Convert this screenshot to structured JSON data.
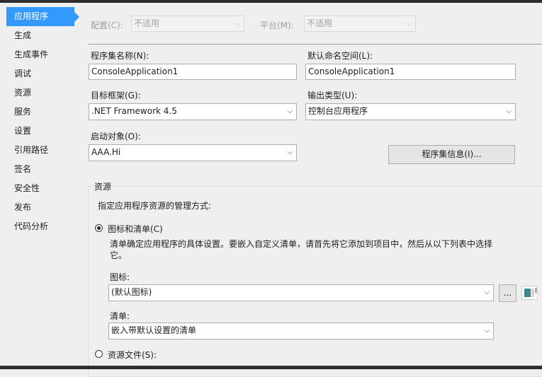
{
  "sidebar": {
    "items": [
      {
        "label": "应用程序",
        "active": true
      },
      {
        "label": "生成"
      },
      {
        "label": "生成事件"
      },
      {
        "label": "调试"
      },
      {
        "label": "资源"
      },
      {
        "label": "服务"
      },
      {
        "label": "设置"
      },
      {
        "label": "引用路径"
      },
      {
        "label": "签名"
      },
      {
        "label": "安全性"
      },
      {
        "label": "发布"
      },
      {
        "label": "代码分析"
      }
    ]
  },
  "config": {
    "label": "配置(C):",
    "value": "不适用",
    "platform_label": "平台(M):",
    "platform_value": "不适用"
  },
  "form": {
    "assembly_name_label": "程序集名称(N):",
    "assembly_name": "ConsoleApplication1",
    "namespace_label": "默认命名空间(L):",
    "namespace": "ConsoleApplication1",
    "framework_label": "目标框架(G):",
    "framework": ".NET Framework 4.5",
    "output_type_label": "输出类型(U):",
    "output_type": "控制台应用程序",
    "startup_label": "启动对象(O):",
    "startup": "AAA.Hi",
    "assembly_info_button": "程序集信息(I)..."
  },
  "resources": {
    "group_label": "资源",
    "instruction": "指定应用程序资源的管理方式:",
    "option_icon_manifest": "图标和清单(C)",
    "description": "清单确定应用程序的具体设置。要嵌入自定义清单，请首先将它添加到项目中，然后从以下列表中选择它。",
    "icon_label": "图标:",
    "icon_value": "(默认图标)",
    "browse_button": "...",
    "manifest_label": "清单:",
    "manifest_value": "嵌入带默认设置的清单",
    "option_resource_file": "资源文件(S):"
  },
  "icons": {
    "chevron": "chevron-down-icon",
    "preview": "icon-preview"
  }
}
